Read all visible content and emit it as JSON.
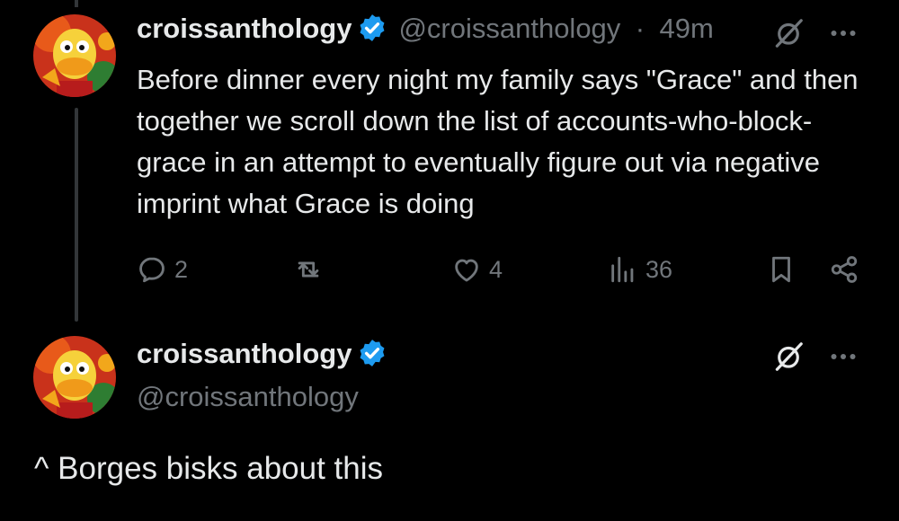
{
  "tweet1": {
    "display_name": "croissanthology",
    "handle": "@croissanthology",
    "separator": "·",
    "time": "49m",
    "text": "Before dinner every night my family says \"Grace\" and then together we scroll down the list of accounts-who-block-grace in an attempt to eventually figure out via negative imprint what Grace is doing",
    "replies": "2",
    "likes": "4",
    "views": "36"
  },
  "tweet2": {
    "display_name": "croissanthology",
    "handle": "@croissanthology",
    "text": "^ Borges bisks about this"
  },
  "colors": {
    "background": "#000000",
    "text": "#e7e9ea",
    "muted": "#71767b",
    "verified": "#1d9bf0",
    "thread_line": "#333639"
  },
  "icons": [
    "avatar",
    "verified-badge-icon",
    "grok-icon",
    "more-icon",
    "reply-icon",
    "retweet-icon",
    "like-icon",
    "views-icon",
    "bookmark-icon",
    "share-icon"
  ]
}
